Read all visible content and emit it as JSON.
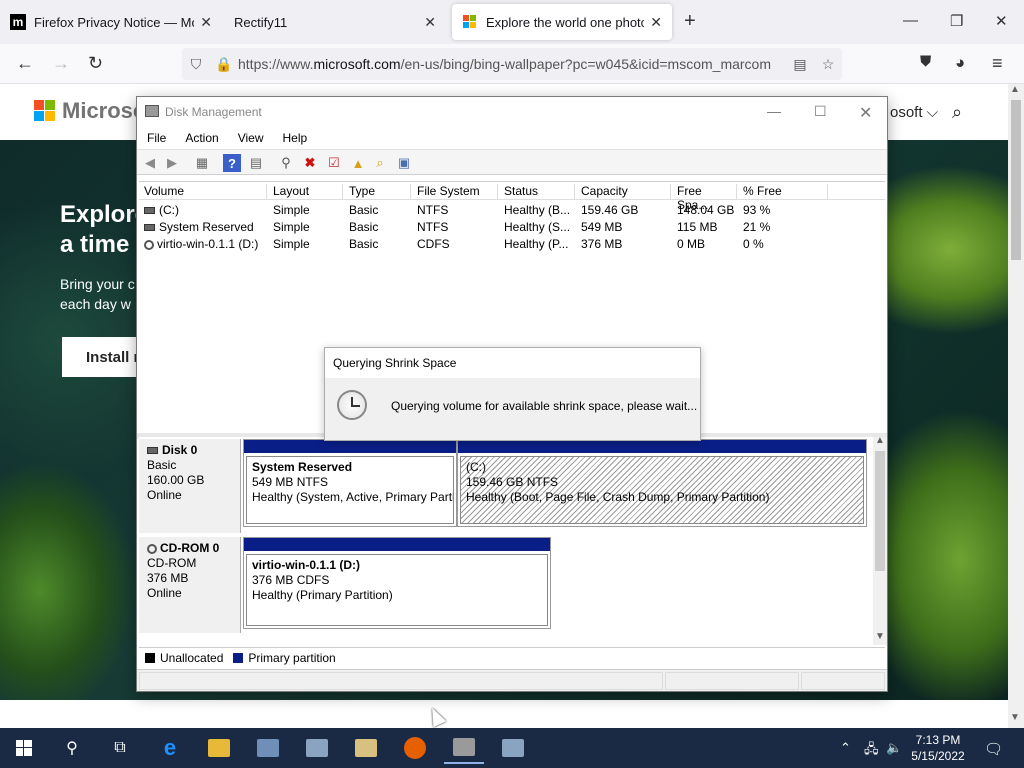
{
  "browser": {
    "tabs": [
      {
        "favicon": "m",
        "title": "Firefox Privacy Notice — Mozilla"
      },
      {
        "favicon": "",
        "title": "Rectify11"
      },
      {
        "favicon": "ms",
        "title": "Explore the world one photo at"
      }
    ],
    "url_prefix": "https://www.",
    "url_domain": "microsoft.com",
    "url_rest": "/en-us/bing/bing-wallpaper?pc=w045&icid=mscom_marcom"
  },
  "webpage": {
    "brand": "Microsoft",
    "header_right": "osoft ⌵",
    "hero_title": "Explore\na time",
    "hero_sub": "Bring your c\neach day w",
    "install_label": "Install n"
  },
  "disk_management": {
    "title": "Disk Management",
    "menu": [
      "File",
      "Action",
      "View",
      "Help"
    ],
    "columns": [
      "Volume",
      "Layout",
      "Type",
      "File System",
      "Status",
      "Capacity",
      "Free Spa...",
      "% Free"
    ],
    "volumes": [
      {
        "volume": "(C:)",
        "layout": "Simple",
        "type": "Basic",
        "fs": "NTFS",
        "status": "Healthy (B...",
        "capacity": "159.46 GB",
        "free": "148.04 GB",
        "pct": "93 %"
      },
      {
        "volume": "System Reserved",
        "layout": "Simple",
        "type": "Basic",
        "fs": "NTFS",
        "status": "Healthy (S...",
        "capacity": "549 MB",
        "free": "115 MB",
        "pct": "21 %"
      },
      {
        "volume": "virtio-win-0.1.1 (D:)",
        "layout": "Simple",
        "type": "Basic",
        "fs": "CDFS",
        "status": "Healthy (P...",
        "capacity": "376 MB",
        "free": "0 MB",
        "pct": "0 %"
      }
    ],
    "disks": [
      {
        "name": "Disk 0",
        "kind": "Basic",
        "size": "160.00 GB",
        "state": "Online",
        "partitions": [
          {
            "name": "System Reserved",
            "size": "549 MB NTFS",
            "status": "Healthy (System, Active, Primary Partition)"
          },
          {
            "name": "(C:)",
            "size": "159.46 GB NTFS",
            "status": "Healthy (Boot, Page File, Crash Dump, Primary Partition)"
          }
        ]
      },
      {
        "name": "CD-ROM 0",
        "kind": "CD-ROM",
        "size": "376 MB",
        "state": "Online",
        "partitions": [
          {
            "name": "virtio-win-0.1.1  (D:)",
            "size": "376 MB CDFS",
            "status": "Healthy (Primary Partition)"
          }
        ]
      }
    ],
    "legend": [
      {
        "label": "Unallocated",
        "color": "#000000"
      },
      {
        "label": "Primary partition",
        "color": "#0a1e88"
      }
    ]
  },
  "dialog": {
    "title": "Querying Shrink Space",
    "message": "Querying volume for available shrink space, please wait..."
  },
  "taskbar": {
    "time": "7:13 PM",
    "date": "5/15/2022"
  },
  "colors": {
    "primary_partition": "#0a1e88",
    "taskbar": "#1a2a44"
  }
}
